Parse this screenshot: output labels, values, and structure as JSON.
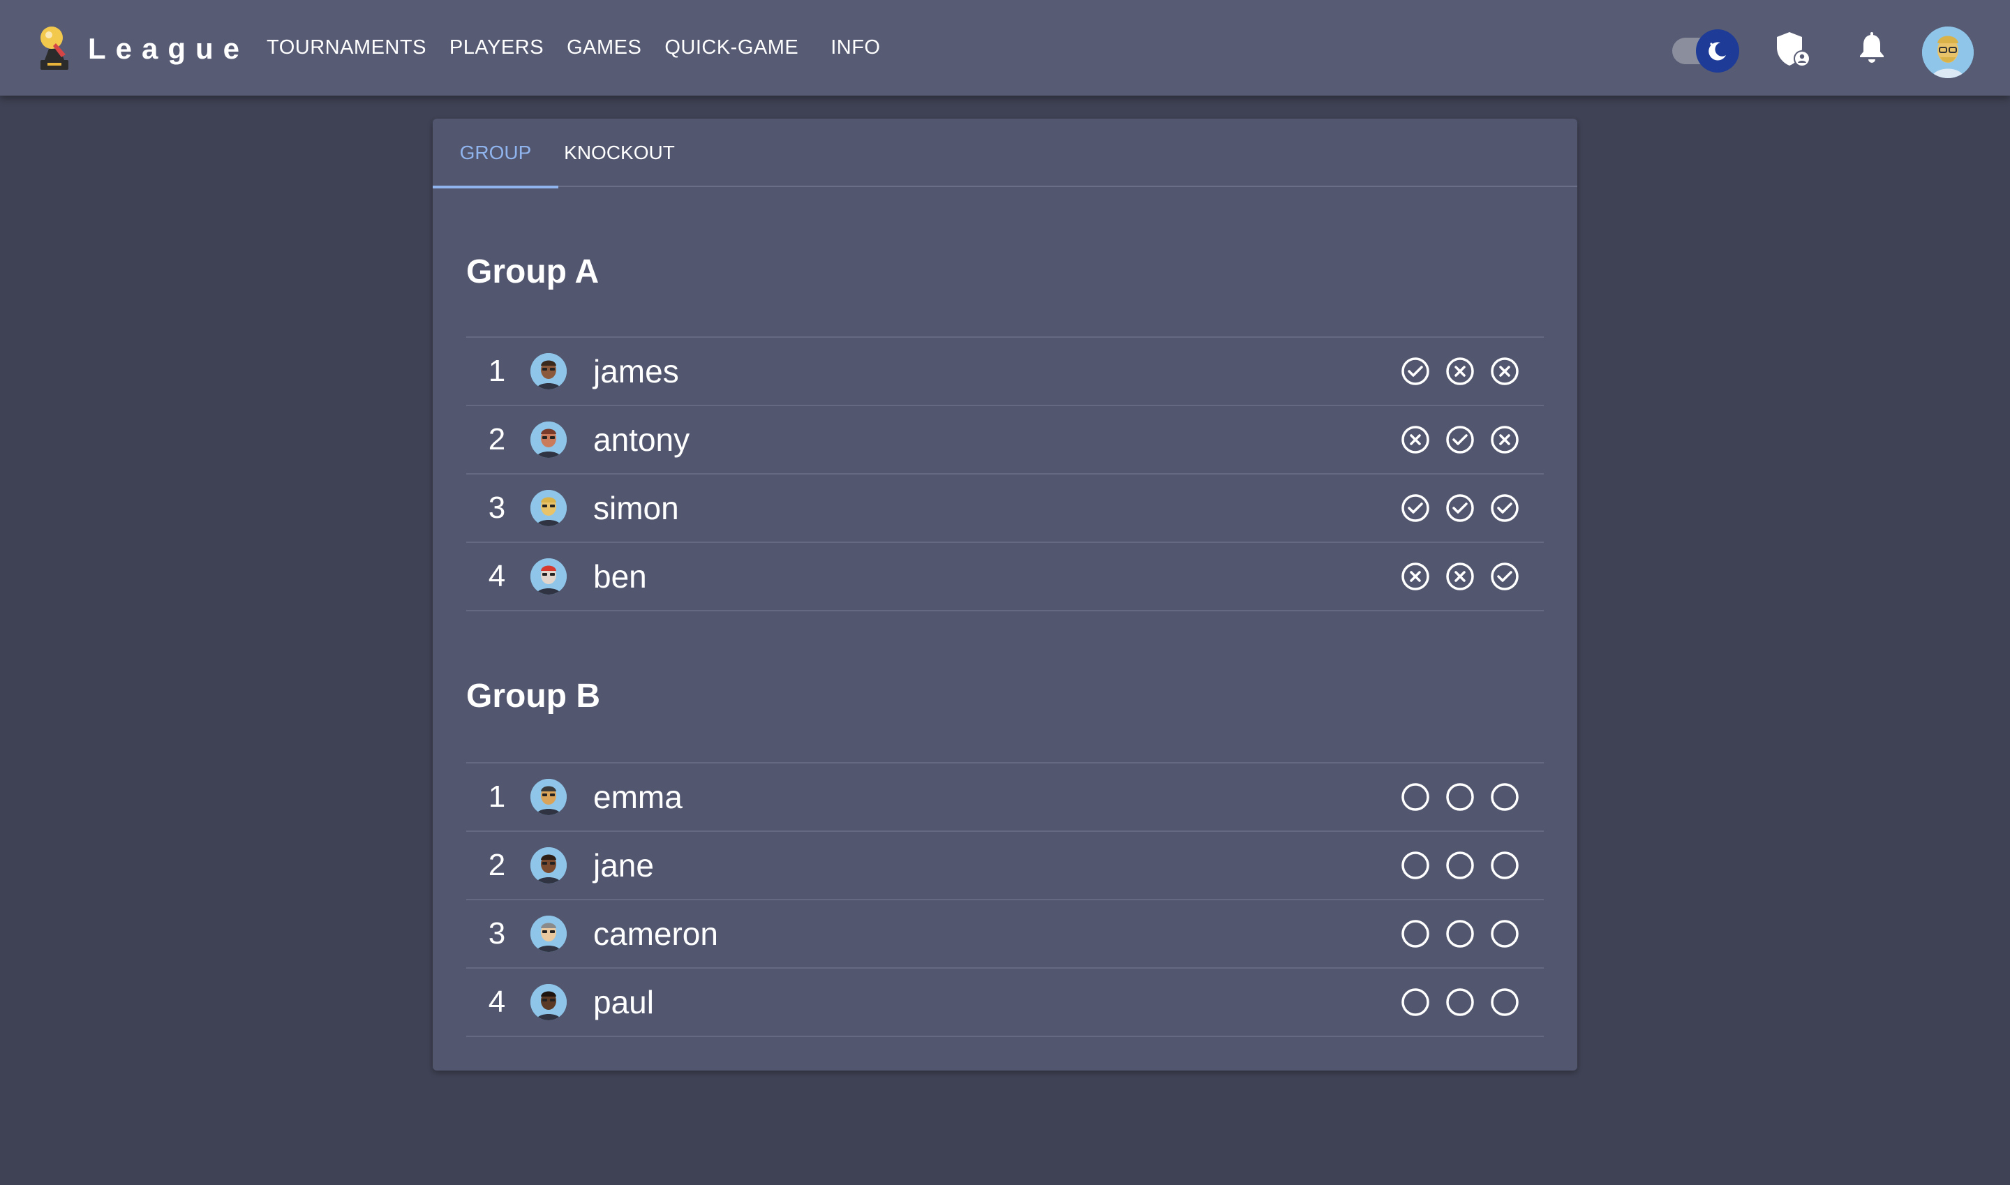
{
  "app": {
    "title": "League"
  },
  "nav": [
    {
      "label": "TOURNAMENTS"
    },
    {
      "label": "PLAYERS"
    },
    {
      "label": "GAMES"
    },
    {
      "label": "QUICK-GAME"
    },
    {
      "label": "INFO"
    }
  ],
  "header_icons": [
    "dark-mode-toggle",
    "admin-shield-icon",
    "notifications-bell-icon",
    "user-avatar"
  ],
  "tabs": [
    {
      "label": "GROUP",
      "active": true
    },
    {
      "label": "KNOCKOUT",
      "active": false
    }
  ],
  "groups": [
    {
      "title": "Group A",
      "players": [
        {
          "rank": "1",
          "name": "james",
          "results": [
            "win",
            "loss",
            "loss"
          ]
        },
        {
          "rank": "2",
          "name": "antony",
          "results": [
            "loss",
            "win",
            "loss"
          ]
        },
        {
          "rank": "3",
          "name": "simon",
          "results": [
            "win",
            "win",
            "win"
          ]
        },
        {
          "rank": "4",
          "name": "ben",
          "results": [
            "loss",
            "loss",
            "win"
          ]
        }
      ]
    },
    {
      "title": "Group B",
      "players": [
        {
          "rank": "1",
          "name": "emma",
          "results": [
            "pending",
            "pending",
            "pending"
          ]
        },
        {
          "rank": "2",
          "name": "jane",
          "results": [
            "pending",
            "pending",
            "pending"
          ]
        },
        {
          "rank": "3",
          "name": "cameron",
          "results": [
            "pending",
            "pending",
            "pending"
          ]
        },
        {
          "rank": "4",
          "name": "paul",
          "results": [
            "pending",
            "pending",
            "pending"
          ]
        }
      ]
    }
  ],
  "colors": {
    "background": "#3f4254",
    "topbar": "#575b74",
    "card": "#52566f",
    "accent": "#90b4ee",
    "toggle_knob": "#1d3b97"
  }
}
